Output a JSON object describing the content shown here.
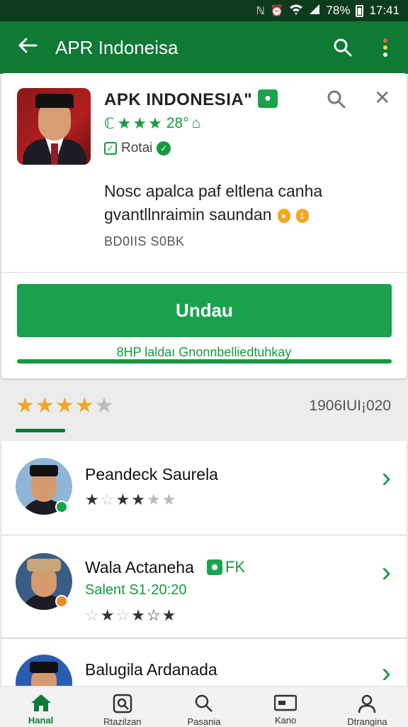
{
  "status_bar": {
    "battery": "78%",
    "time": "17:41",
    "icons": [
      "n-icon",
      "alarm-icon",
      "wifi-icon",
      "signal-icon",
      "battery-icon"
    ]
  },
  "app_bar": {
    "title": "APR Indoneisa",
    "back_icon": "arrow-left-icon",
    "search_icon": "search-icon",
    "menu_icon": "more-vertical-icon",
    "menu_dot_colors": [
      "#ff5a3c",
      "#ffd43b",
      "#ffffff"
    ]
  },
  "app": {
    "name": "APK INDONESIA\"",
    "rating_text": "28°",
    "verified_label": "Rotai",
    "description_line1": "Nosc apalca paf eltlena canha",
    "description_line2": "gvantllnraimin saundan",
    "size": "BD0IIS S0BK",
    "install_button": "Undau",
    "install_note": "8HP laldaı Gnonnbelliedtuhkay"
  },
  "summary": {
    "stars_on": 4,
    "stars_total": 5,
    "count": "1906IUI¡020"
  },
  "reviews": [
    {
      "name": "Peandeck Saurela",
      "stars": [
        1,
        0.5,
        1,
        1,
        0,
        0
      ]
    },
    {
      "name": "Wala Actaneha",
      "tag": "FK",
      "date": "Salent S1·20:20",
      "stars": [
        0,
        1,
        0,
        1,
        0.5,
        1
      ]
    },
    {
      "name": "Balugila Ardanada"
    }
  ],
  "bottom_nav": [
    {
      "label": "Hanal",
      "icon": "home-icon",
      "active": true
    },
    {
      "label": "Rtazilzan",
      "icon": "search-doc-icon",
      "active": false
    },
    {
      "label": "Pasania",
      "icon": "search-icon",
      "active": false
    },
    {
      "label": "Kano",
      "icon": "card-icon",
      "active": false
    },
    {
      "label": "Dtrangina",
      "icon": "person-icon",
      "active": false
    }
  ],
  "colors": {
    "primary": "#0e7a34",
    "accent": "#1aa14d",
    "star": "#f3a52a",
    "status_bar": "#0e3b1e"
  }
}
